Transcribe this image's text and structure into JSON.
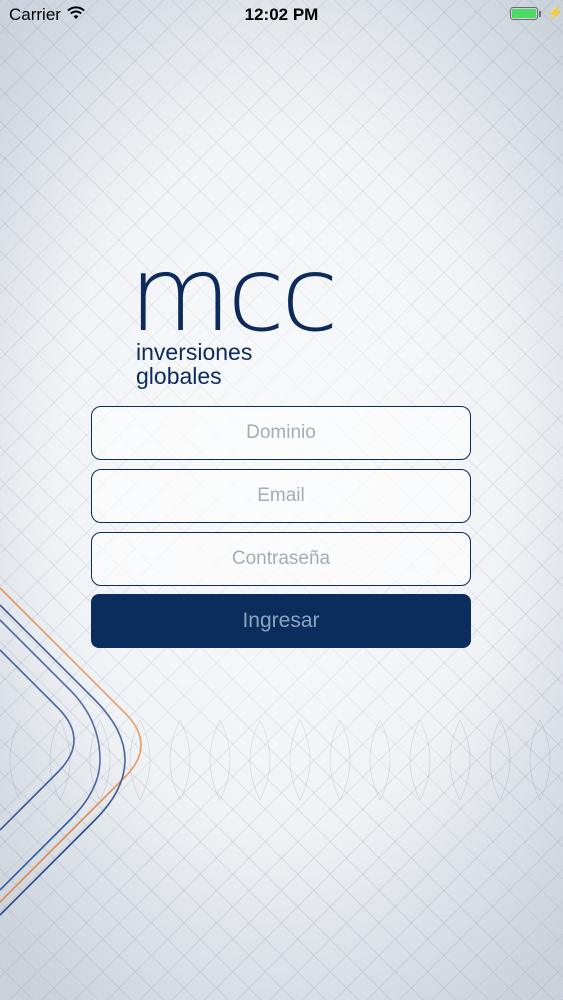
{
  "status_bar": {
    "carrier": "Carrier",
    "time": "12:02 PM",
    "wifi_icon": "wifi-icon",
    "battery_icon": "battery-icon",
    "charging_icon": "charging-bolt-icon",
    "charging_symbol": "⚡"
  },
  "logo": {
    "wordmark": "mcc",
    "line1": "inversiones",
    "line2": "globales",
    "color": "#0d2b5a"
  },
  "login_form": {
    "domain_placeholder": "Dominio",
    "email_placeholder": "Email",
    "password_placeholder": "Contraseña",
    "submit_label": "Ingresar"
  },
  "colors": {
    "primary": "#0b2d5e",
    "button_text": "#8fa2c0",
    "placeholder": "#a4acb8",
    "accent_orange": "#e0894a",
    "line_blue": "#3b5a99"
  }
}
